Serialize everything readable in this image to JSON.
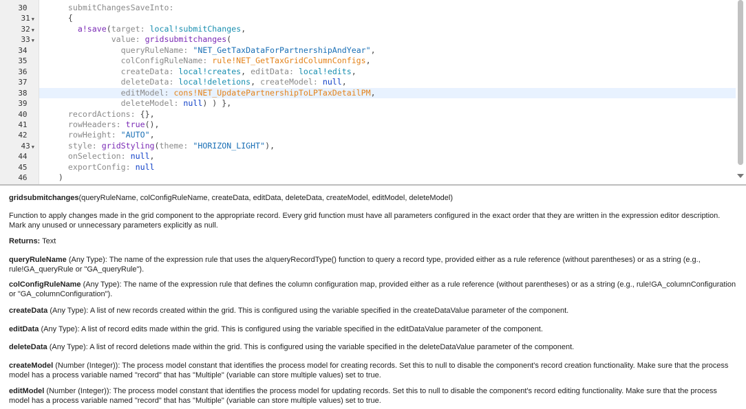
{
  "editor": {
    "highlighted_line": 38,
    "lines": [
      {
        "n": "30",
        "fold": false
      },
      {
        "n": "31",
        "fold": true
      },
      {
        "n": "32",
        "fold": true
      },
      {
        "n": "33",
        "fold": true
      },
      {
        "n": "34",
        "fold": false
      },
      {
        "n": "35",
        "fold": false
      },
      {
        "n": "36",
        "fold": false
      },
      {
        "n": "37",
        "fold": false
      },
      {
        "n": "38",
        "fold": false
      },
      {
        "n": "39",
        "fold": false
      },
      {
        "n": "40",
        "fold": false
      },
      {
        "n": "41",
        "fold": false
      },
      {
        "n": "42",
        "fold": false
      },
      {
        "n": "43",
        "fold": true
      },
      {
        "n": "44",
        "fold": false
      },
      {
        "n": "45",
        "fold": false
      },
      {
        "n": "46",
        "fold": false
      }
    ],
    "code": [
      [
        [
          "      submitChangesSaveInto:",
          "k"
        ]
      ],
      [
        [
          "      {",
          "p"
        ]
      ],
      [
        [
          "        a!save",
          "fn"
        ],
        [
          "(",
          "p"
        ],
        [
          "target: ",
          "k"
        ],
        [
          "local!submitChanges",
          "lc"
        ],
        [
          ",",
          "p"
        ]
      ],
      [
        [
          "               value: ",
          "k"
        ],
        [
          "gridsubmitchanges",
          "fn"
        ],
        [
          "(",
          "p"
        ]
      ],
      [
        [
          "                 queryRuleName: ",
          "k"
        ],
        [
          "\"NET_GetTaxDataForPartnershipAndYear\"",
          "s"
        ],
        [
          ",",
          "p"
        ]
      ],
      [
        [
          "                 colConfigRuleName: ",
          "k"
        ],
        [
          "rule!NET_GetTaxGridColumnConfigs",
          "r"
        ],
        [
          ",",
          "p"
        ]
      ],
      [
        [
          "                 createData: ",
          "k"
        ],
        [
          "local!creates",
          "lc"
        ],
        [
          ", ",
          "p"
        ],
        [
          "editData: ",
          "k"
        ],
        [
          "local!edits",
          "lc"
        ],
        [
          ",",
          "p"
        ]
      ],
      [
        [
          "                 deleteData: ",
          "k"
        ],
        [
          "local!deletions",
          "lc"
        ],
        [
          ", ",
          "p"
        ],
        [
          "createModel: ",
          "k"
        ],
        [
          "null",
          "v"
        ],
        [
          ",",
          "p"
        ]
      ],
      [
        [
          "                 editModel: ",
          "k"
        ],
        [
          "cons!NET_UpdatePartnershipToLPTaxDetailPM",
          "r"
        ],
        [
          ",",
          "p"
        ]
      ],
      [
        [
          "                 deleteModel: ",
          "k"
        ],
        [
          "null",
          "v"
        ],
        [
          ") ) },",
          "p"
        ]
      ],
      [
        [
          "      recordActions: ",
          "k"
        ],
        [
          "{}",
          "p"
        ],
        [
          ",",
          "p"
        ]
      ],
      [
        [
          "      rowHeaders: ",
          "k"
        ],
        [
          "true",
          "fn"
        ],
        [
          "(),",
          "p"
        ]
      ],
      [
        [
          "      rowHeight: ",
          "k"
        ],
        [
          "\"AUTO\"",
          "s"
        ],
        [
          ",",
          "p"
        ]
      ],
      [
        [
          "      style: ",
          "k"
        ],
        [
          "gridStyling",
          "fn"
        ],
        [
          "(",
          "p"
        ],
        [
          "theme: ",
          "k"
        ],
        [
          "\"HORIZON_LIGHT\"",
          "s"
        ],
        [
          "),",
          "p"
        ]
      ],
      [
        [
          "      onSelection: ",
          "k"
        ],
        [
          "null",
          "v"
        ],
        [
          ",",
          "p"
        ]
      ],
      [
        [
          "      exportConfig: ",
          "k"
        ],
        [
          "null",
          "v"
        ]
      ],
      [
        [
          "    )",
          "p"
        ]
      ]
    ]
  },
  "doc": {
    "signature_name": "gridsubmitchanges",
    "signature_params": "(queryRuleName, colConfigRuleName, createData, editData, deleteData, createModel, editModel, deleteModel)",
    "description": "Function to apply changes made in the grid component to the appropriate record. Every grid function must have all parameters configured in the exact order that they are written in the expression editor description. Mark any unused or unnecessary parameters explicitly as null.",
    "returns_label": "Returns:",
    "returns_value": " Text",
    "params": [
      {
        "name": "queryRuleName",
        "text": " (Any Type): The name of the expression rule that uses the a!queryRecordType() function to query a record type, provided either as a rule reference (without parentheses) or as a string (e.g., rule!GA_queryRule or  \"GA_queryRule\")."
      },
      {
        "name": "colConfigRuleName",
        "text": " (Any Type): The name of the expression rule that defines the column configuration map, provided either as a rule reference (without parentheses) or as a string (e.g., rule!GA_columnConfiguration or \"GA_columnConfiguration\")."
      },
      {
        "name": "createData",
        "text": " (Any Type): A list of new records created within the grid. This is configured using the variable specified in the createDataValue parameter of the component."
      },
      {
        "name": "editData",
        "text": " (Any Type): A list of record edits made within the grid. This is configured using the variable specified in the editDataValue parameter of the component."
      },
      {
        "name": "deleteData",
        "text": " (Any Type): A list of record deletions made within the grid. This is configured using the variable specified in the deleteDataValue parameter of the component."
      },
      {
        "name": "createModel",
        "text": " (Number (Integer)): The process model constant that identifies the process model for creating records. Set this to null to disable the component's record creation functionality. Make sure that the process model has a process variable named \"record\" that has \"Multiple\" (variable can store multiple values) set to true."
      },
      {
        "name": "editModel",
        "text": " (Number (Integer)): The process model constant that identifies the process model for updating records. Set this to null to disable the component's record editing functionality. Make sure that the process model has a process variable named \"record\" that has \"Multiple\" (variable can store multiple values) set to true."
      }
    ]
  }
}
